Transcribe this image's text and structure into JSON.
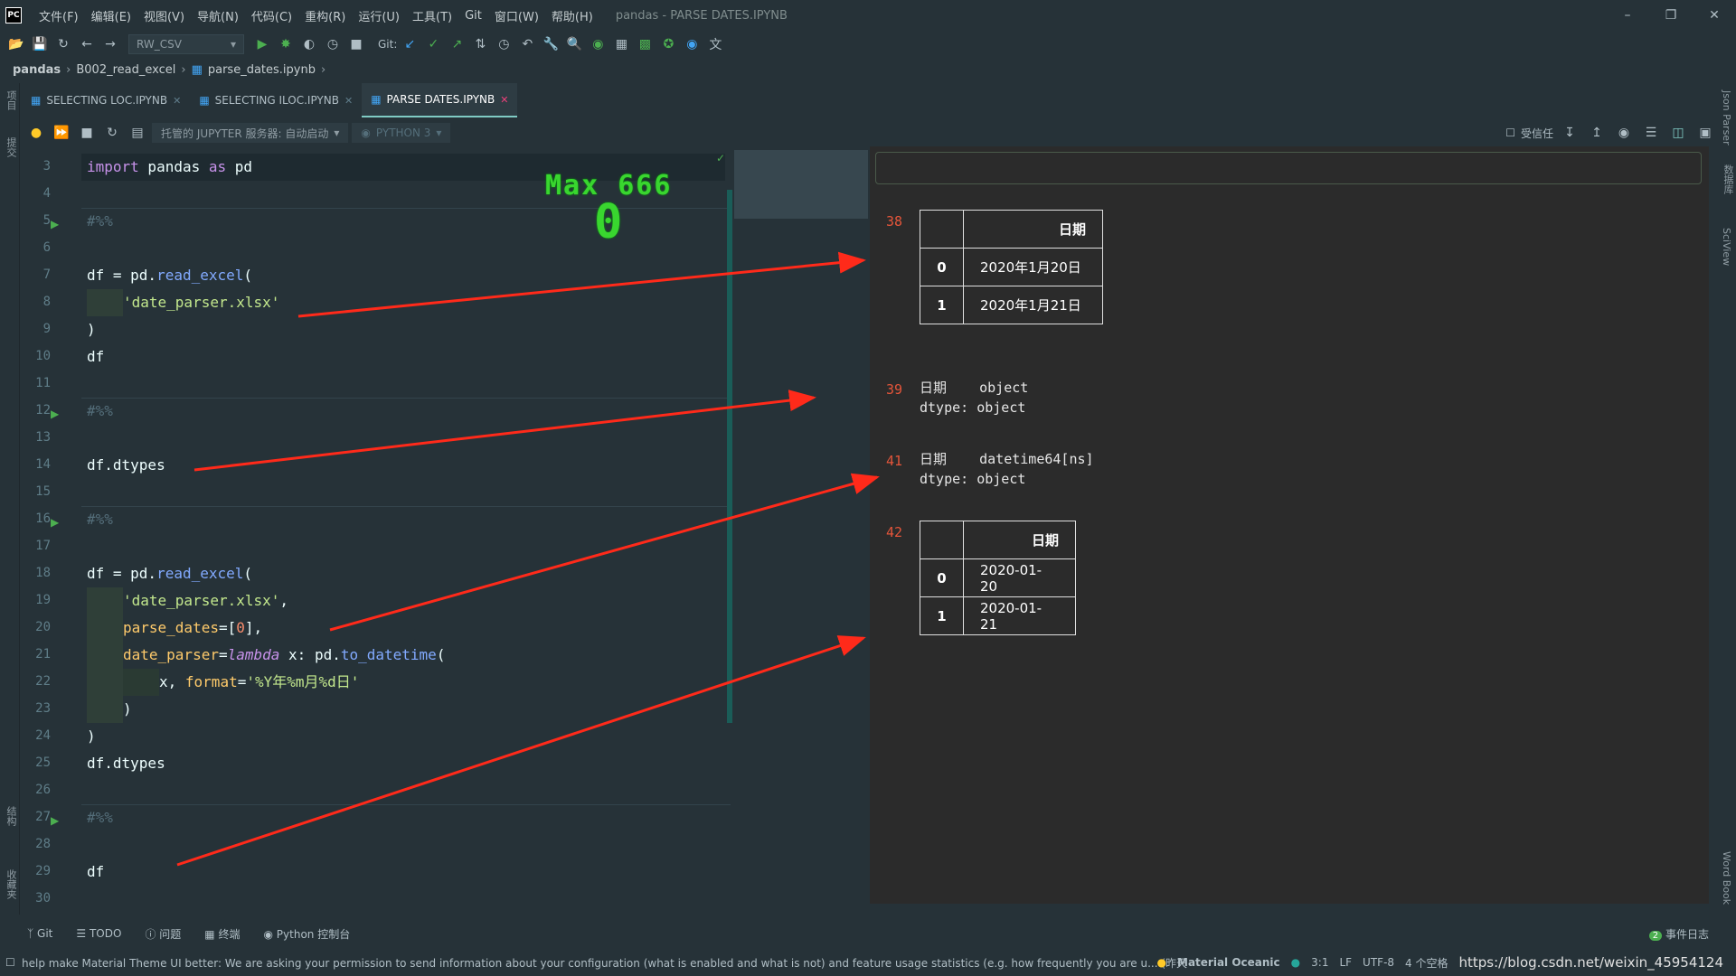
{
  "app": {
    "logo": "PC",
    "window_title": "pandas - PARSE DATES.IPYNB"
  },
  "menu": [
    "文件(F)",
    "编辑(E)",
    "视图(V)",
    "导航(N)",
    "代码(C)",
    "重构(R)",
    "运行(U)",
    "工具(T)",
    "Git",
    "窗口(W)",
    "帮助(H)"
  ],
  "toolbar": {
    "run_config": "RW_CSV",
    "git_label": "Git:"
  },
  "breadcrumb": [
    "pandas",
    "B002_read_excel",
    "parse_dates.ipynb"
  ],
  "tabs": [
    {
      "label": "SELECTING LOC.IPYNB"
    },
    {
      "label": "SELECTING ILOC.IPYNB"
    },
    {
      "label": "PARSE DATES.IPYNB"
    }
  ],
  "notebook_toolbar": {
    "server": "托管的 JUPYTER 服务器: 自动启动",
    "kernel": "PYTHON 3",
    "trusted": "受信任"
  },
  "left_vertical_labels": [
    "项目",
    "提交",
    "结构",
    "收藏夹"
  ],
  "right_vertical_labels": [
    "Json Parser",
    "数据库",
    "SciView",
    "Word Book"
  ],
  "line_numbers": [
    "3",
    "4",
    "5",
    "6",
    "7",
    "8",
    "9",
    "10",
    "11",
    "12",
    "13",
    "14",
    "15",
    "16",
    "17",
    "18",
    "19",
    "20",
    "21",
    "22",
    "23",
    "24",
    "25",
    "26",
    "27",
    "28",
    "29",
    "30"
  ],
  "code": {
    "l3a": "import",
    "l3b": " pandas ",
    "l3c": "as",
    "l3d": " pd",
    "cell_marker": "#%%",
    "l7a": "df = pd.",
    "l7b": "read_excel",
    "l7c": "(",
    "l8": "'date_parser.xlsx'",
    "l9": ")",
    "l10": "df",
    "l14": "df.dtypes",
    "l18a": "df = pd.",
    "l18b": "read_excel",
    "l18c": "(",
    "l19a": "'date_parser.xlsx'",
    "l19b": ",",
    "l20a": "parse_dates",
    "l20b": "=[",
    "l20c": "0",
    "l20d": "],",
    "l21a": "date_parser",
    "l21b": "=",
    "l21c": "lambda",
    "l21d": " x: pd.",
    "l21e": "to_datetime",
    "l21f": "(",
    "l22a": "x, ",
    "l22b": "format",
    "l22c": "=",
    "l22d": "'%Y年%m月%d日'",
    "l23": ")",
    "l24": ")",
    "l25": "df.dtypes",
    "l29": "df"
  },
  "overlay": {
    "line1": "Max 666",
    "line2": "0"
  },
  "outputs": {
    "o38": {
      "num": "38",
      "header": "日期",
      "rows": [
        [
          "0",
          "2020年1月20日"
        ],
        [
          "1",
          "2020年1月21日"
        ]
      ]
    },
    "o39": {
      "num": "39",
      "text": "日期    object\ndtype: object"
    },
    "o41": {
      "num": "41",
      "text": "日期    datetime64[ns]\ndtype: object"
    },
    "o42": {
      "num": "42",
      "header": "日期",
      "rows": [
        [
          "0",
          "2020-01-20"
        ],
        [
          "1",
          "2020-01-21"
        ]
      ]
    }
  },
  "bottom_tools": [
    "Git",
    "TODO",
    "问题",
    "终端",
    "Python 控制台"
  ],
  "event_log": "事件日志",
  "event_count": "2",
  "status": {
    "message": "help make Material Theme UI better: We are asking your permission to send information about your configuration (what is enabled and what is not) and feature usage statistics (e.g. how frequently you are u... (昨天 15:17)",
    "theme": "Material Oceanic",
    "position": "3:1",
    "line_sep": "LF",
    "encoding": "UTF-8",
    "indent": "4 个空格",
    "watermark": "https://blog.csdn.net/weixin_45954124"
  },
  "colors": {
    "accent": "#80cbc4",
    "arrow": "#ff2a1a",
    "overlay_text": "#39d62f",
    "output_number": "#e4553a"
  }
}
